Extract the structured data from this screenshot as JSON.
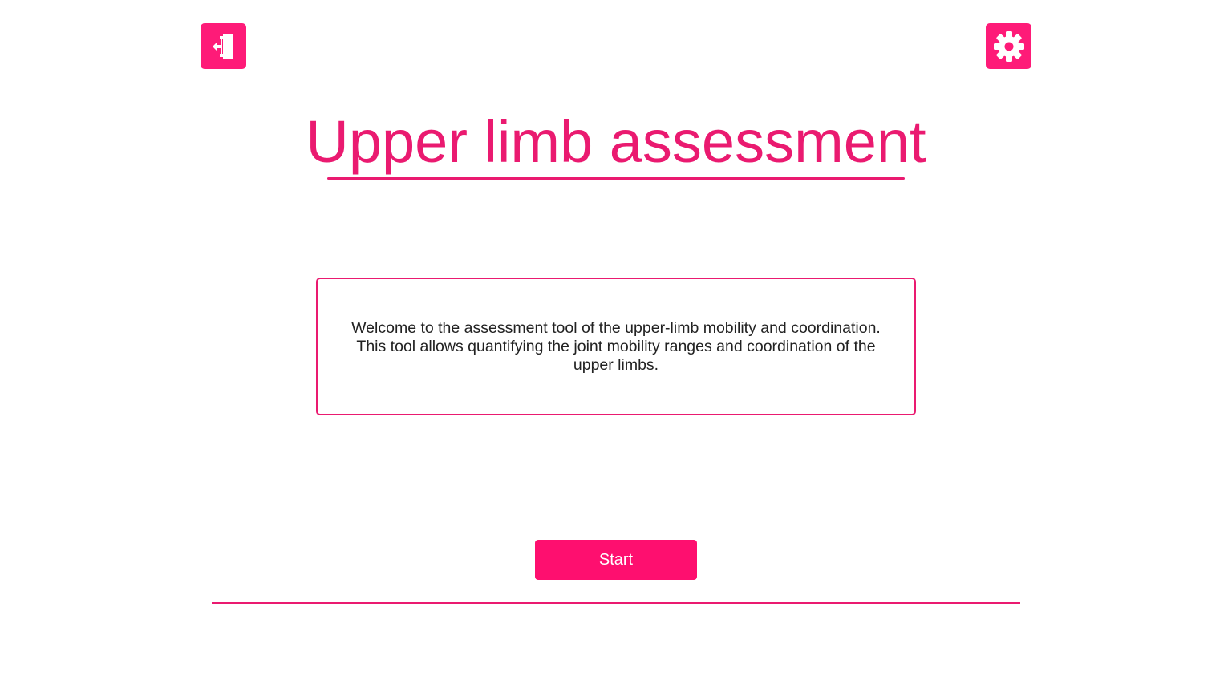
{
  "header": {
    "exit_icon": "exit-door-icon",
    "settings_icon": "gear-icon"
  },
  "main": {
    "title": "Upper limb assessment",
    "welcome_text": "Welcome to the assessment tool of the upper-limb mobility and coordination. This tool allows quantifying the joint mobility ranges and coordination of the upper limbs.",
    "start_label": "Start"
  },
  "colors": {
    "accent": "#fe1b78",
    "title": "#ea1a70",
    "text": "#222222",
    "background": "#ffffff"
  }
}
